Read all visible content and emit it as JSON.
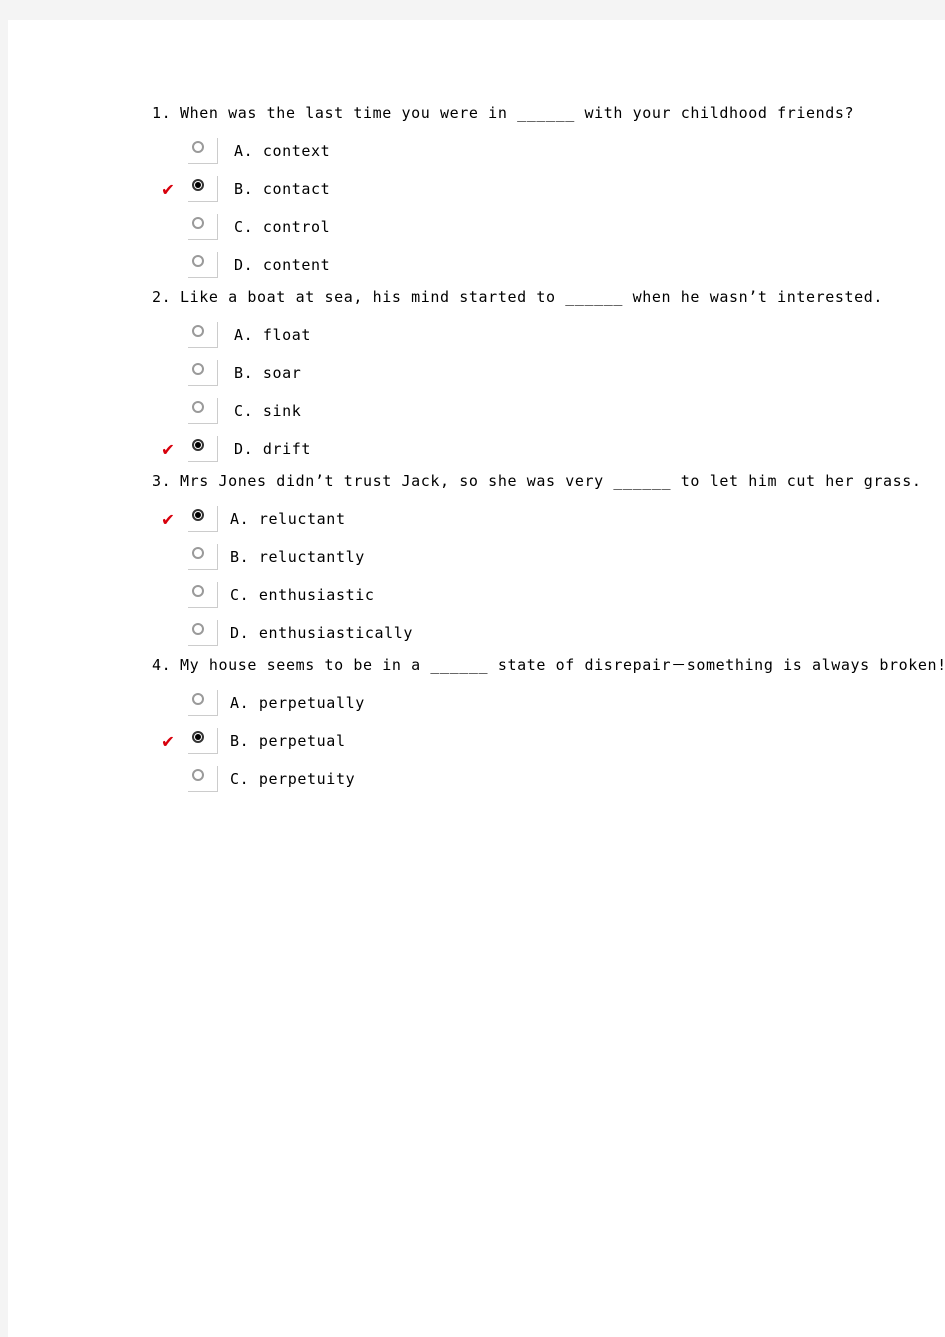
{
  "document": {
    "type": "multiple-choice-quiz",
    "page_background": "#f4f4f4",
    "sheet_background": "#ffffff",
    "check_mark_color": "#d8000c",
    "check_mark_glyph": "✔"
  },
  "questions": [
    {
      "number": "1.",
      "text": "When was the last time you were in ______ with your childhood friends?",
      "spacing": "normal",
      "options": [
        {
          "label": "A. context",
          "checked": false
        },
        {
          "label": "B. contact",
          "checked": true
        },
        {
          "label": "C. control",
          "checked": false
        },
        {
          "label": "D. content",
          "checked": false
        }
      ]
    },
    {
      "number": "2.",
      "text": "Like a boat at sea, his mind started to ______ when he wasn’t interested.",
      "spacing": "normal",
      "options": [
        {
          "label": "A. float",
          "checked": false
        },
        {
          "label": "B. soar",
          "checked": false
        },
        {
          "label": "C. sink",
          "checked": false
        },
        {
          "label": "D. drift",
          "checked": true
        }
      ]
    },
    {
      "number": "3.",
      "text": "Mrs Jones didn’t trust Jack, so she was very ______ to let him cut her grass.",
      "spacing": "tight",
      "options": [
        {
          "label": "A. reluctant",
          "checked": true
        },
        {
          "label": "B. reluctantly",
          "checked": false
        },
        {
          "label": "C. enthusiastic",
          "checked": false
        },
        {
          "label": "D. enthusiastically",
          "checked": false
        }
      ]
    },
    {
      "number": "4.",
      "text": "My house seems to be in a ______ state of disrepair－something is always broken!",
      "spacing": "tight",
      "options": [
        {
          "label": "A. perpetually",
          "checked": false
        },
        {
          "label": "B. perpetual",
          "checked": true
        },
        {
          "label": "C. perpetuity",
          "checked": false
        }
      ]
    }
  ]
}
